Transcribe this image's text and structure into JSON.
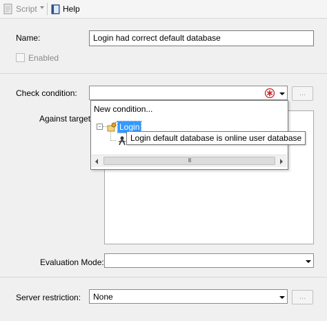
{
  "toolbar": {
    "script_label": "Script",
    "help_label": "Help"
  },
  "form": {
    "name_label": "Name:",
    "name_value": "Login had correct default database",
    "enabled_label": "Enabled",
    "enabled_checked": false,
    "check_condition_label": "Check condition:",
    "check_condition_value": "",
    "browse_label": "...",
    "against_targets_label": "Against targets",
    "evaluation_mode_label": "Evaluation Mode:",
    "evaluation_mode_value": "",
    "server_restriction_label": "Server restriction:",
    "server_restriction_value": "None",
    "server_restriction_browse_label": "..."
  },
  "dropdown": {
    "new_condition_label": "New condition...",
    "tree": {
      "expander": "-",
      "root_label": "Login",
      "child_label": "Login default database is online user database"
    },
    "scrollbar_grip": "III"
  },
  "colors": {
    "selection": "#3399ff",
    "error_icon": "#c0282f",
    "panel": "#f0f0f0"
  },
  "icons": {
    "script": "script-icon",
    "help": "help-book-icon",
    "error": "error-icon",
    "condition": "condition-icon",
    "facet": "facet-icon"
  }
}
